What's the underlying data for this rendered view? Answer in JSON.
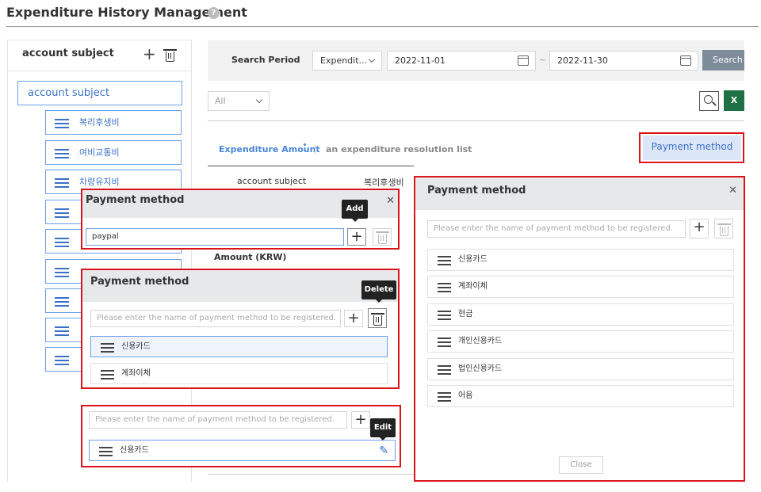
{
  "page": {
    "title": "Expenditure History Management"
  },
  "left_panel": {
    "title": "account subject",
    "root_label": "account subject",
    "items": [
      "복리후생비",
      "여비교통비",
      "차량유지비",
      "",
      "",
      "",
      "",
      "",
      ""
    ]
  },
  "search": {
    "period_label": "Search Period",
    "type_value": "Expendit...",
    "date_from": "2022-11-01",
    "separator": "~",
    "date_to": "2022-11-30",
    "button": "Search"
  },
  "filter": {
    "all_value": "All",
    "excel_label": "X"
  },
  "tabs": {
    "active": "Expenditure Amount",
    "inactive": "an expenditure resolution list"
  },
  "table": {
    "col_account": "account subject",
    "col_value": "복리후생비",
    "amount_label": "Amount (KRW)"
  },
  "payment_button": "Payment method",
  "popup_add": {
    "title": "Payment method",
    "input_value": "paypal",
    "tooltip": "Add"
  },
  "popup_delete": {
    "title": "Payment method",
    "placeholder": "Please enter the name of payment method to be registered.",
    "tooltip": "Delete",
    "items": [
      "신용카드",
      "계좌이체"
    ]
  },
  "popup_edit": {
    "placeholder": "Please enter the name of payment method to be registered.",
    "tooltip": "Edit",
    "item": "신용카드"
  },
  "popup_main": {
    "title": "Payment method",
    "placeholder": "Please enter the name of payment method to be registered.",
    "items": [
      "신용카드",
      "계좌이체",
      "현금",
      "개인신용카드",
      "법인신용카드",
      "어음"
    ],
    "close": "Close"
  },
  "colors": {
    "accent": "#3a70c8",
    "highlight": "#d9141c",
    "excel": "#1e7145"
  }
}
